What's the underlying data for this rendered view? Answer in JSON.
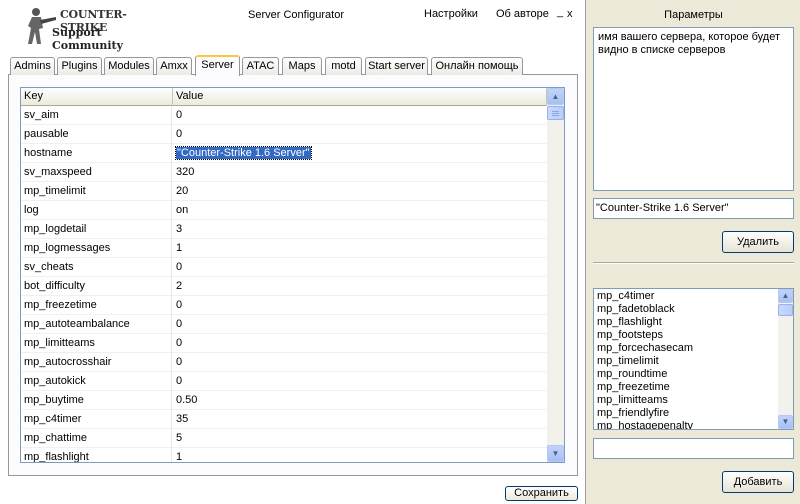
{
  "header": {
    "logo_line1": "COUNTER-STRIKE",
    "logo_line2": "Support Community",
    "app_title": "Server Configurator",
    "menu_settings": "Настройки",
    "menu_about": "Об авторе",
    "minimize": "_",
    "close": "x"
  },
  "tabs": [
    {
      "label": "Admins",
      "active": false
    },
    {
      "label": "Plugins",
      "active": false
    },
    {
      "label": "Modules",
      "active": false
    },
    {
      "label": "Amxx",
      "active": false
    },
    {
      "label": "Server",
      "active": true
    },
    {
      "label": "ATAC",
      "active": false
    },
    {
      "label": "Maps",
      "active": false
    },
    {
      "label": "motd",
      "active": false
    },
    {
      "label": "Start server",
      "active": false
    },
    {
      "label": "Онлайн помощь",
      "active": false
    }
  ],
  "grid": {
    "columns": [
      "Key",
      "Value"
    ],
    "selected_row": 2,
    "rows": [
      {
        "key": "sv_aim",
        "value": "0"
      },
      {
        "key": "pausable",
        "value": "0"
      },
      {
        "key": "hostname",
        "value": "\"Counter-Strike 1.6 Server\""
      },
      {
        "key": "sv_maxspeed",
        "value": "320"
      },
      {
        "key": "mp_timelimit",
        "value": "20"
      },
      {
        "key": "log",
        "value": "on"
      },
      {
        "key": "mp_logdetail",
        "value": "3"
      },
      {
        "key": "mp_logmessages",
        "value": "1"
      },
      {
        "key": "sv_cheats",
        "value": "0"
      },
      {
        "key": "bot_difficulty",
        "value": "2"
      },
      {
        "key": "mp_freezetime",
        "value": "0"
      },
      {
        "key": "mp_autoteambalance",
        "value": "0"
      },
      {
        "key": "mp_limitteams",
        "value": "0"
      },
      {
        "key": "mp_autocrosshair",
        "value": "0"
      },
      {
        "key": "mp_autokick",
        "value": "0"
      },
      {
        "key": "mp_buytime",
        "value": "0.50"
      },
      {
        "key": "mp_c4timer",
        "value": "35"
      },
      {
        "key": "mp_chattime",
        "value": "5"
      },
      {
        "key": "mp_flashlight",
        "value": "1"
      }
    ]
  },
  "save_button": "Сохранить",
  "params": {
    "title": "Параметры",
    "description": "имя вашего сервера, которое будет видно в списке серверов",
    "value": "\"Counter-Strike 1.6 Server\"",
    "delete_button": "Удалить",
    "add_button": "Добавить",
    "new_value": "",
    "available_vars": [
      "mp_c4timer",
      "mp_fadetoblack",
      "mp_flashlight",
      "mp_footsteps",
      "mp_forcechasecam",
      "mp_timelimit",
      "mp_roundtime",
      "mp_freezetime",
      "mp_limitteams",
      "mp_friendlyfire",
      "mp_hostagepenalty"
    ]
  },
  "colors": {
    "selection": "#316ac5",
    "active_tab_accent": "#ffc83c",
    "border_blue": "#7f9db9",
    "button_border": "#003c74",
    "window_bg": "#ece9d8"
  }
}
